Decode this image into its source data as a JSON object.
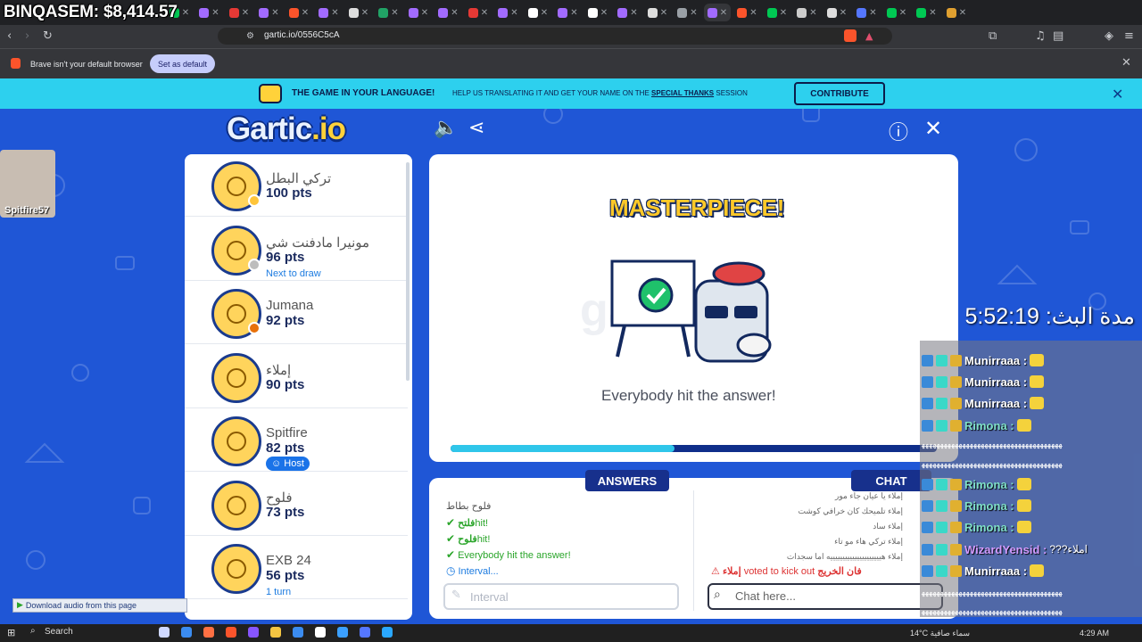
{
  "overlay": {
    "money": "BINQASEM: $8,414.57",
    "webcam_label": "Spitfire57",
    "stream_timer": "مدة البث: 5:52:19",
    "download_audio": "Download audio from this page"
  },
  "browser": {
    "url": "gartic.io/0556C5cA",
    "infobar_text": "Brave isn't your default browser",
    "set_default_label": "Set as default"
  },
  "banner": {
    "title": "THE GAME IN YOUR LANGUAGE!",
    "help_text_pre": "HELP US TRANSLATING IT AND GET YOUR NAME ON THE",
    "help_text_link": "SPECIAL THANKS",
    "help_text_post": "SESSION",
    "contribute_label": "CONTRIBUTE"
  },
  "game": {
    "logo": "Gartic",
    "logo_suffix": "io",
    "status_title": "MASTERPIECE!",
    "status_message": "Everybody hit the answer!",
    "round_progress": 0.46
  },
  "players": [
    {
      "name": "تركي البطل",
      "points": "100 pts",
      "note": "",
      "badge_color": "#ffc53a"
    },
    {
      "name": "مونيرا مادفنت شي",
      "points": "96 pts",
      "note": "Next to draw",
      "badge_color": "#bdbdbd"
    },
    {
      "name": "Jumana",
      "points": "92 pts",
      "note": "",
      "badge_color": "#e8710a"
    },
    {
      "name": "إملاء",
      "points": "90 pts",
      "note": "",
      "badge_color": ""
    },
    {
      "name": "Spitfire",
      "points": "82 pts",
      "note": "",
      "host": "Host",
      "badge_color": ""
    },
    {
      "name": "فلوح",
      "points": "73 pts",
      "note": "",
      "badge_color": ""
    },
    {
      "name": "EXB 24",
      "points": "56 pts",
      "note": "1 turn",
      "badge_color": ""
    }
  ],
  "answers": {
    "tab_label": "ANSWERS",
    "lines": [
      {
        "text": "فلوح بطاط",
        "style": "gray"
      },
      {
        "who": "فلتح",
        "text": "hit!",
        "style": "green"
      },
      {
        "who": "فلوح",
        "text": "hit!",
        "style": "green"
      },
      {
        "text": "Everybody hit the answer!",
        "style": "green"
      },
      {
        "text": "Interval...",
        "style": "blue"
      }
    ],
    "input_placeholder": "Interval"
  },
  "chat": {
    "tab_label": "CHAT",
    "lines": [
      "إملاء يا عيان جاء مور",
      "إملاء تلميحك كان خرافي كوشت",
      "إملاء ساد",
      "إملاء تركي هاء مو تاء",
      "إملاء هيييييييييييييييييييييه اما سجدات"
    ],
    "kick_who": "إملاء",
    "kick_text": "voted to kick out",
    "kick_target": "فان الخريج",
    "input_placeholder": "Chat here..."
  },
  "stream_chat": [
    {
      "name": "Munirraaa :",
      "msg": "",
      "color": "#ffffff"
    },
    {
      "name": "Munirraaa :",
      "msg": "",
      "color": "#ffffff"
    },
    {
      "name": "Munirraaa :",
      "msg": "",
      "color": "#ffffff"
    },
    {
      "name": "Rimona :",
      "msg": "",
      "color": "#7fe0c8"
    },
    {
      "name": "Rimona :",
      "msg": "",
      "color": "#7fe0c8"
    },
    {
      "name": "Rimona :",
      "msg": "",
      "color": "#7fe0c8"
    },
    {
      "name": "Rimona :",
      "msg": "",
      "color": "#7fe0c8"
    },
    {
      "name": "WizardYensid :",
      "msg": "???املاء",
      "color": "#d39bff"
    },
    {
      "name": "Munirraaa :",
      "msg": "",
      "color": "#ffffff"
    }
  ],
  "stream_chat_wide": "ﻬﻬﻬﻬﻬﻬﻬﻬﻬﻬﻬﻬﻬﻬﻬﻬﻬﻬﻬﻬﻬﻬﻬﻬﻬﻬﻬﻬﻬﻬﻬﻬﻬﻬﻬﻬﻬﻬ",
  "taskbar": {
    "search": "Search",
    "weather": "14°C  سماء صافية",
    "clock": "4:29 AM"
  }
}
